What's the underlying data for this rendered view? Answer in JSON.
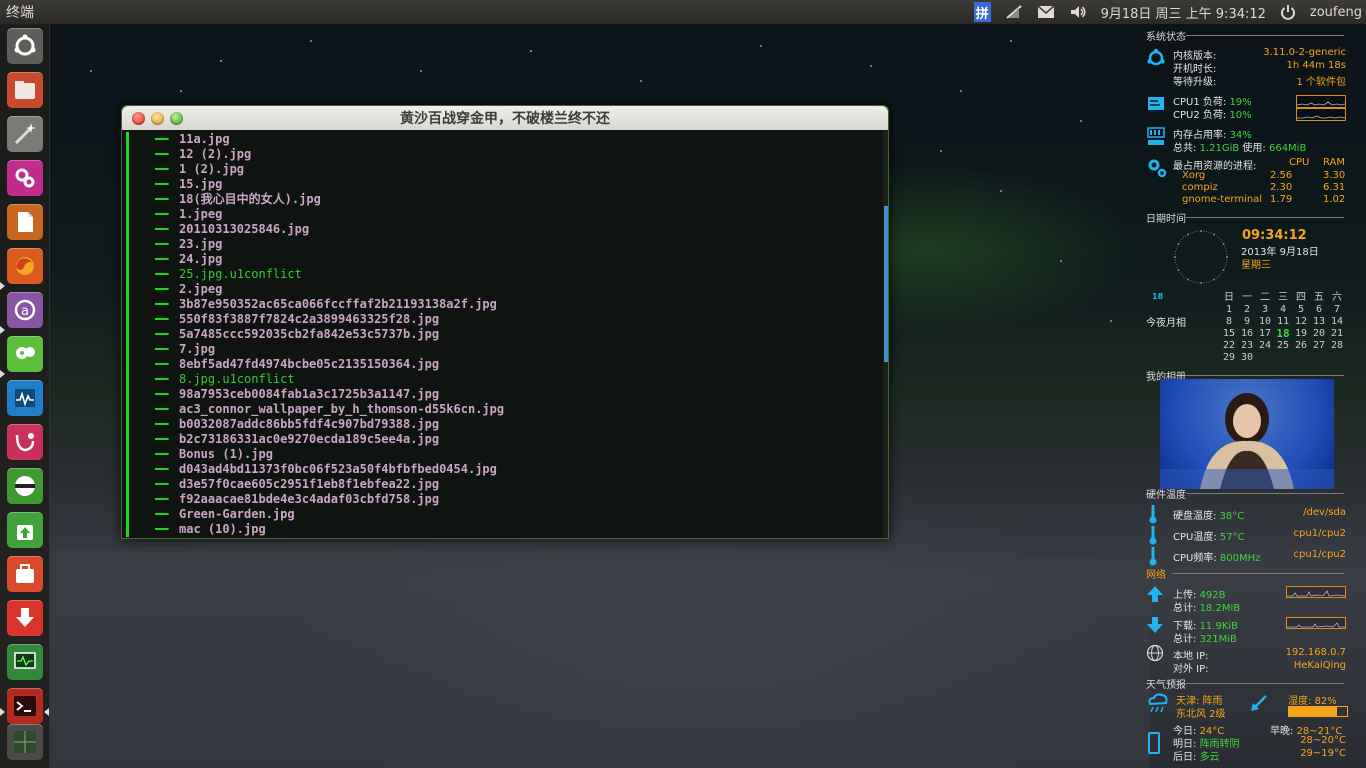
{
  "top_panel": {
    "app_title": "终端",
    "input_method": "拼",
    "clock": "9月18日 周三 上午 9:34:12",
    "user": "zoufeng"
  },
  "launcher": {
    "items": [
      {
        "name": "ubuntu-dash",
        "color": "#6a6a66"
      },
      {
        "name": "files",
        "color": "#c8492b"
      },
      {
        "name": "system-settings-tool",
        "color": "#8a8a86"
      },
      {
        "name": "unity-tweak",
        "color": "#c02b8f"
      },
      {
        "name": "libreoffice",
        "color": "#c8651f"
      },
      {
        "name": "firefox",
        "color": "#d95b1d"
      },
      {
        "name": "ubuntu-software",
        "color": "#8a54a4"
      },
      {
        "name": "pidgin",
        "color": "#5bbf3a"
      },
      {
        "name": "system-monitor",
        "color": "#1f7fc8"
      },
      {
        "name": "empathy",
        "color": "#c8325a"
      },
      {
        "name": "disks",
        "color": "#4aa33a"
      },
      {
        "name": "software-updater",
        "color": "#3fa33a"
      },
      {
        "name": "bag-app",
        "color": "#d94a2b"
      },
      {
        "name": "download-manager",
        "color": "#d9352b"
      },
      {
        "name": "monitor-app",
        "color": "#2f8a3a"
      },
      {
        "name": "terminal",
        "color": "#b32b1f"
      },
      {
        "name": "workspace-switcher",
        "color": "#4a4a46"
      }
    ]
  },
  "terminal": {
    "title": "黄沙百战穿金甲，不破楼兰终不还",
    "branch": "━━",
    "lines": [
      {
        "text": "11a.jpg",
        "conflict": false
      },
      {
        "text": "12 (2).jpg",
        "conflict": false
      },
      {
        "text": "1 (2).jpg",
        "conflict": false
      },
      {
        "text": "15.jpg",
        "conflict": false
      },
      {
        "text": "18(我心目中的女人).jpg",
        "conflict": false
      },
      {
        "text": "1.jpeg",
        "conflict": false
      },
      {
        "text": "20110313025846.jpg",
        "conflict": false
      },
      {
        "text": "23.jpg",
        "conflict": false
      },
      {
        "text": "24.jpg",
        "conflict": false
      },
      {
        "text": "25.jpg.u1conflict",
        "conflict": true
      },
      {
        "text": "2.jpeg",
        "conflict": false
      },
      {
        "text": "3b87e950352ac65ca066fccffaf2b21193138a2f.jpg",
        "conflict": false
      },
      {
        "text": "550f83f3887f7824c2a3899463325f28.jpg",
        "conflict": false
      },
      {
        "text": "5a7485ccc592035cb2fa842e53c5737b.jpg",
        "conflict": false
      },
      {
        "text": "7.jpg",
        "conflict": false
      },
      {
        "text": "8ebf5ad47fd4974bcbe05c2135150364.jpg",
        "conflict": false
      },
      {
        "text": "8.jpg.u1conflict",
        "conflict": true
      },
      {
        "text": "98a7953ceb0084fab1a3c1725b3a1147.jpg",
        "conflict": false
      },
      {
        "text": "ac3_connor_wallpaper_by_h_thomson-d55k6cn.jpg",
        "conflict": false
      },
      {
        "text": "b0032087addc86bb5fdf4c907bd79388.jpg",
        "conflict": false
      },
      {
        "text": "b2c73186331ac0e9270ecda189c5ee4a.jpg",
        "conflict": false
      },
      {
        "text": "Bonus (1).jpg",
        "conflict": false
      },
      {
        "text": "d043ad4bd11373f0bc06f523a50f4bfbfbed0454.jpg",
        "conflict": false
      },
      {
        "text": "d3e57f0cae605c2951f1eb8f1ebfea22.jpg",
        "conflict": false
      },
      {
        "text": "f92aaacae81bde4e3c4adaf03cbfd758.jpg",
        "conflict": false
      },
      {
        "text": "Green-Garden.jpg",
        "conflict": false
      },
      {
        "text": "mac (10).jpg",
        "conflict": false
      }
    ]
  },
  "conky": {
    "system": {
      "title": "系统状态",
      "kernel_label": "内核版本:",
      "kernel_value": "3.11.0-2-generic",
      "uptime_label": "开机时长:",
      "uptime_value": "1h 44m 18s",
      "upgrade_label": "等待升级:",
      "upgrade_value": "1 个软件包",
      "cpu1_label": "CPU1 负荷:",
      "cpu1_value": "19%",
      "cpu2_label": "CPU2 负荷:",
      "cpu2_value": "10%",
      "mem_label": "内存占用率:",
      "mem_value": "34%",
      "total_label": "总共:",
      "total_value": "1.21GiB",
      "used_label": "使用:",
      "used_value": "664MiB",
      "top_label": "最占用资源的进程:",
      "top_cpu": "CPU",
      "top_ram": "RAM",
      "processes": [
        {
          "name": "Xorg",
          "cpu": "2.56",
          "ram": "3.30"
        },
        {
          "name": "compiz",
          "cpu": "2.30",
          "ram": "6.31"
        },
        {
          "name": "gnome-terminal",
          "cpu": "1.79",
          "ram": "1.02"
        }
      ]
    },
    "datetime": {
      "title": "日期时间",
      "time": "09:34:12",
      "date": "2013年  9月18日",
      "weekday": "星期三",
      "moon_day": "18",
      "moon_label": "今夜月相",
      "cal_header": [
        "日",
        "一",
        "二",
        "三",
        "四",
        "五",
        "六"
      ],
      "cal_rows": [
        [
          "",
          "",
          "",
          "",
          "",
          "",
          "",
          ""
        ],
        [
          "1",
          "2",
          "3",
          "4",
          "5",
          "6",
          "7"
        ],
        [
          "8",
          "9",
          "10",
          "11",
          "12",
          "13",
          "14"
        ],
        [
          "15",
          "16",
          "17",
          "18",
          "19",
          "20",
          "21"
        ],
        [
          "22",
          "23",
          "24",
          "25",
          "26",
          "27",
          "28"
        ],
        [
          "29",
          "30",
          "",
          "",
          "",
          "",
          ""
        ]
      ],
      "today": "18"
    },
    "album": {
      "title": "我的相册"
    },
    "temps": {
      "title": "硬件温度",
      "disk_label": "硬盘温度:",
      "disk_value": "38°C",
      "disk_dev": "/dev/sda",
      "cpu_label": "CPU温度:",
      "cpu_value": "57°C",
      "cpu_dev": "cpu1/cpu2",
      "freq_label": "CPU频率:",
      "freq_value": "800MHz",
      "freq_dev": "cpu1/cpu2"
    },
    "network": {
      "title": "网络",
      "up_label": "上传:",
      "up_value": "492B",
      "up_total_label": "总计:",
      "up_total_value": "18.2MiB",
      "down_label": "下载:",
      "down_value": "11.9KiB",
      "down_total_label": "总计:",
      "down_total_value": "321MiB",
      "local_ip_label": "本地 IP:",
      "local_ip_value": "192.168.0.7",
      "ext_ip_label": "对外 IP:",
      "ext_ip_value": "HeKaiQing"
    },
    "weather": {
      "title": "天气预报",
      "city": "天津: 阵雨",
      "wind": "东北风 2级",
      "humidity_label": "湿度:",
      "humidity_value": "82%",
      "humidity_fraction": 0.82,
      "today_label": "今日:",
      "today_value": "24°C",
      "morning_label": "早晚:",
      "morning_value": "28~21°C",
      "tomorrow_label": "明日:",
      "tomorrow_value": "阵雨转阴",
      "tomorrow_temp": "28~20°C",
      "after_label": "后日:",
      "after_value": "多云",
      "after_temp": "29~19°C"
    }
  }
}
